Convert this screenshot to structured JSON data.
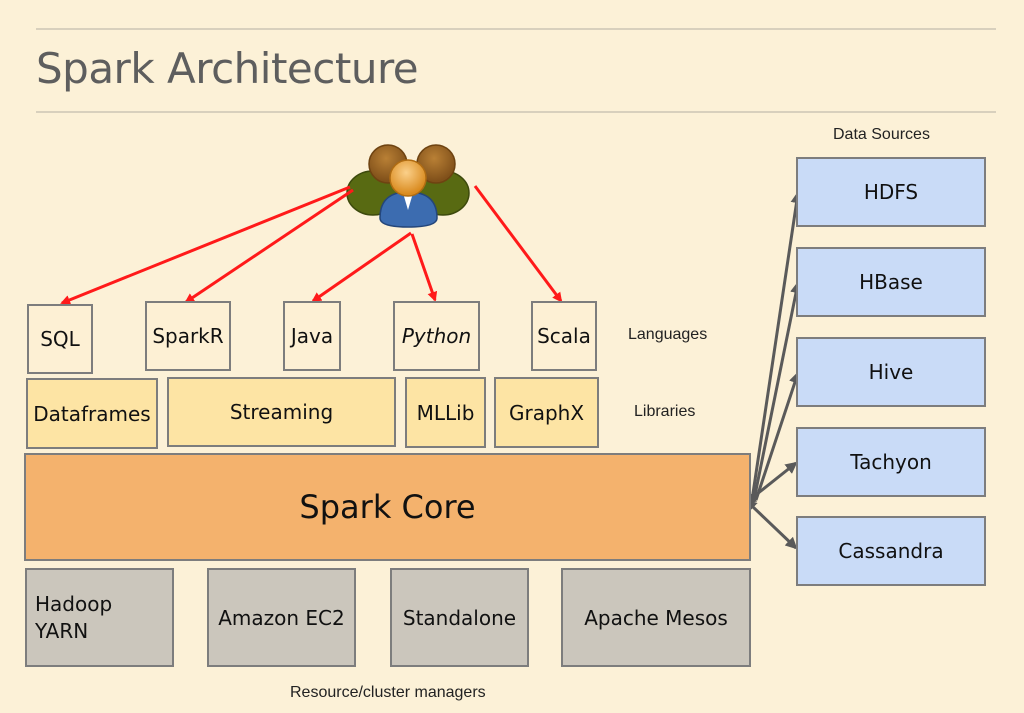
{
  "title": "Spark Architecture",
  "users_icon": "users-group-icon",
  "colors": {
    "background": "#fcf1d7",
    "language_box": "#fdf0d4",
    "library_box": "#fde4a4",
    "core_box": "#f4b26d",
    "manager_box": "#cbc6bc",
    "source_box": "#c9dbf7",
    "user_arrows": "#ff1a1a",
    "source_arrows": "#5a5a5a"
  },
  "languages": {
    "label": "Languages",
    "items": [
      {
        "name": "SQL",
        "italic": false
      },
      {
        "name": "SparkR",
        "italic": false
      },
      {
        "name": "Java",
        "italic": false
      },
      {
        "name": "Python",
        "italic": true
      },
      {
        "name": "Scala",
        "italic": false
      }
    ]
  },
  "libraries": {
    "label": "Libraries",
    "items": [
      "Dataframes",
      "Streaming",
      "MLLib",
      "GraphX"
    ]
  },
  "core": {
    "label": "Spark Core"
  },
  "managers": {
    "label": "Resource/cluster managers",
    "items": [
      "Hadoop YARN",
      "Amazon EC2",
      "Standalone",
      "Apache Mesos"
    ],
    "hadoop_line1": "Hadoop",
    "hadoop_line2": "YARN"
  },
  "data_sources": {
    "label": "Data Sources",
    "items": [
      "HDFS",
      "HBase",
      "Hive",
      "Tachyon",
      "Cassandra"
    ]
  }
}
